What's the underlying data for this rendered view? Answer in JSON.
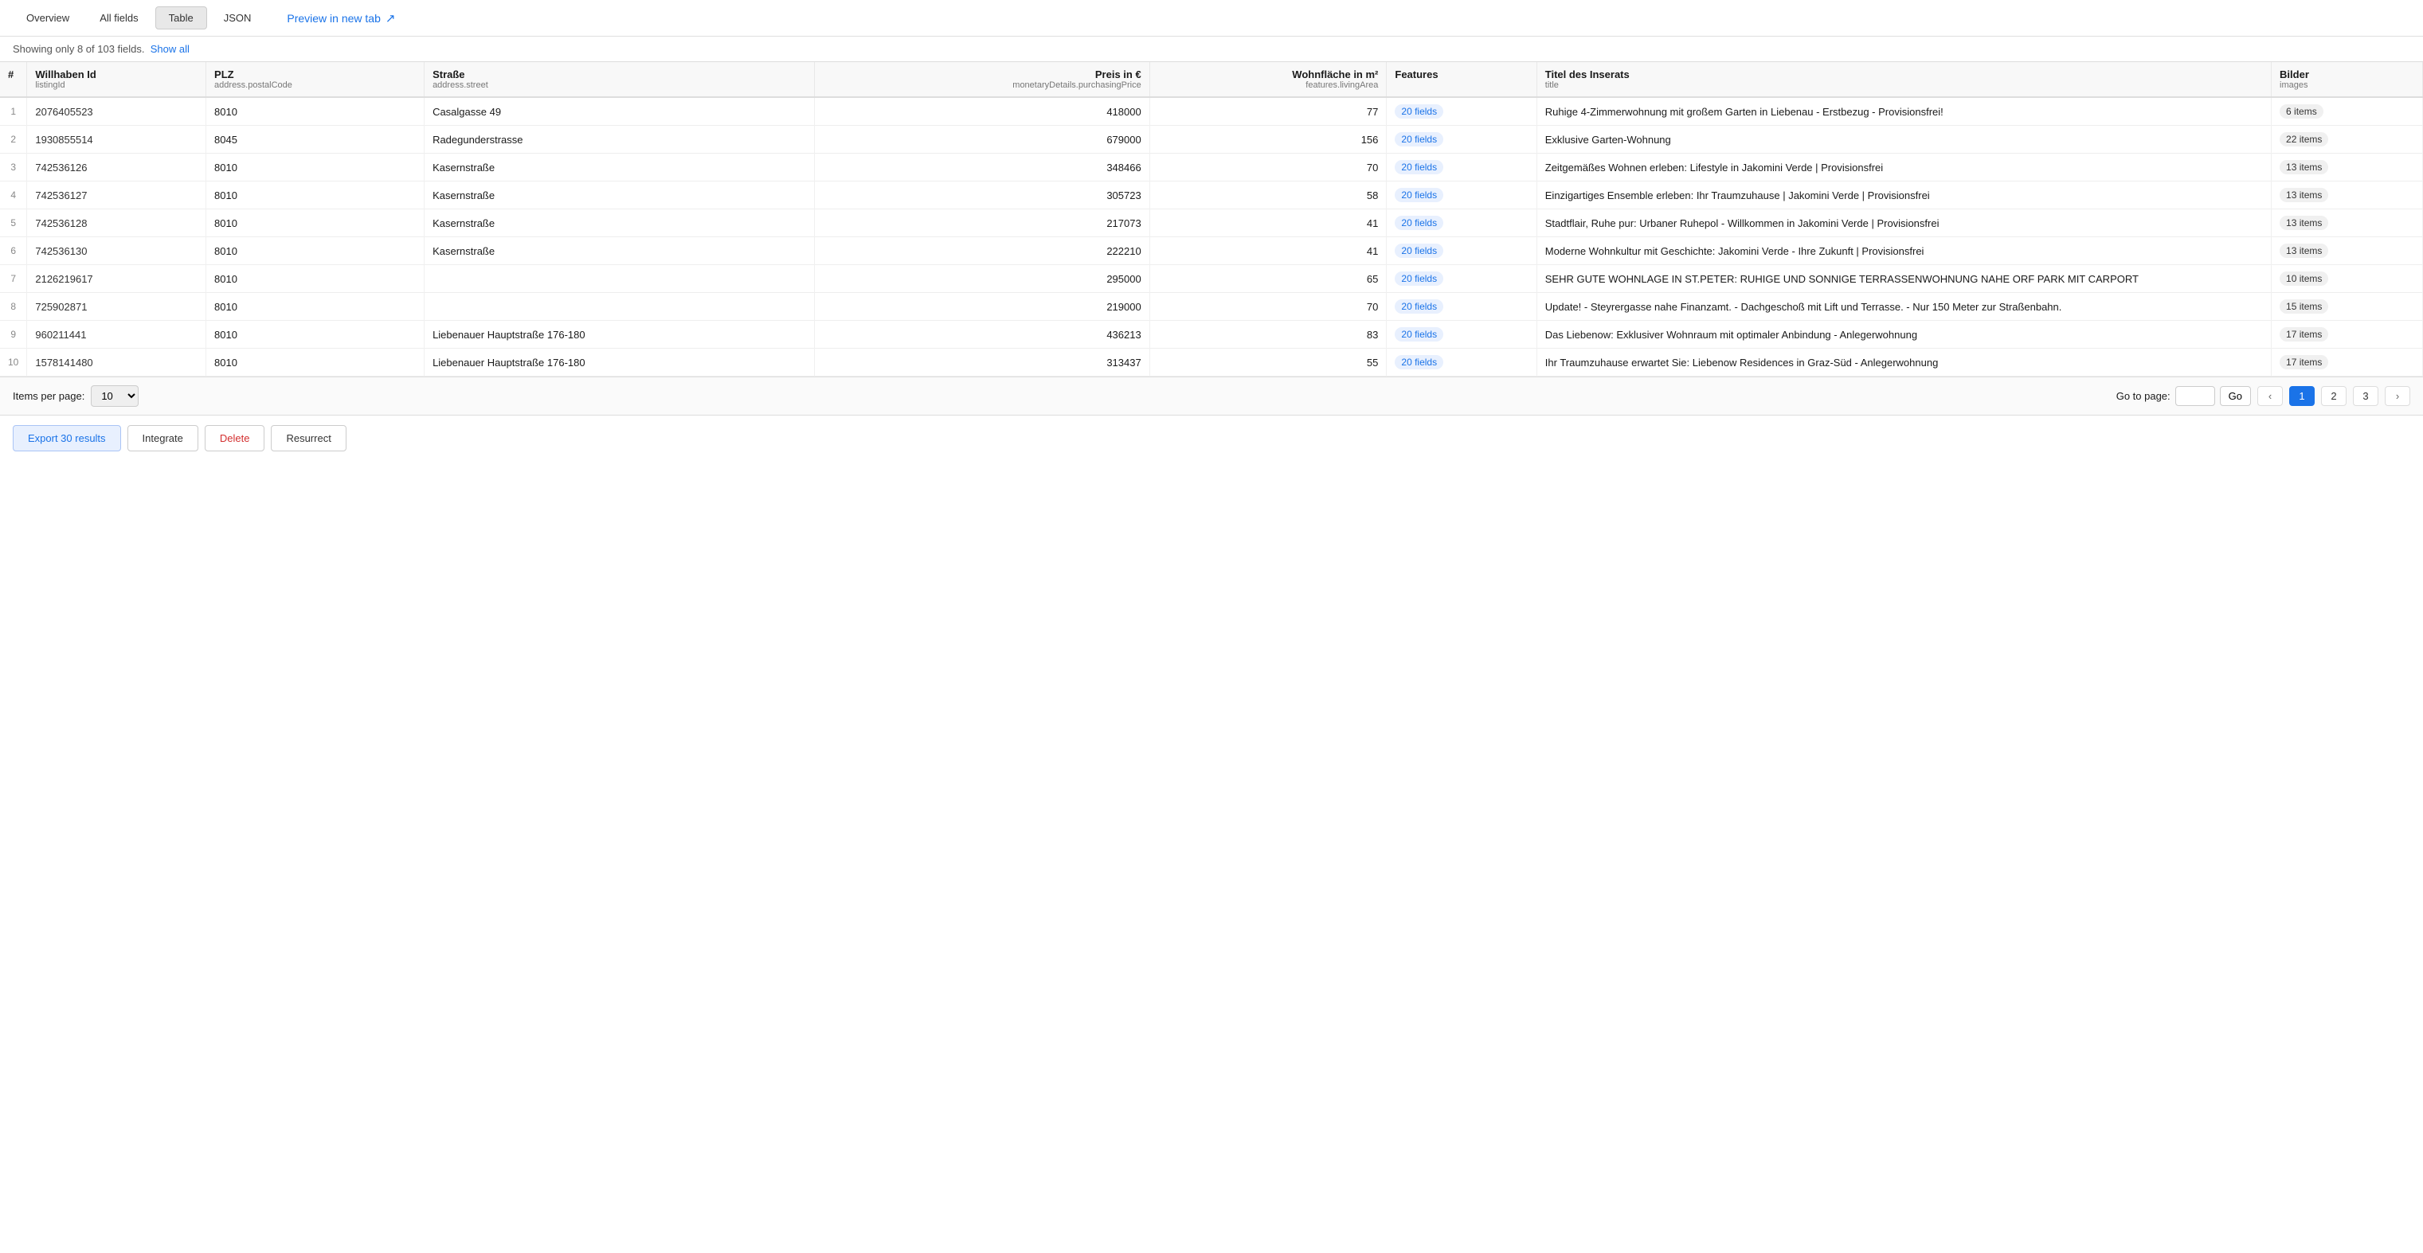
{
  "tabs": {
    "overview": "Overview",
    "all_fields": "All fields",
    "table": "Table",
    "json": "JSON",
    "active": "Table"
  },
  "preview": {
    "label": "Preview in new tab",
    "icon": "↗"
  },
  "info_bar": {
    "text_prefix": "Showing only 8 of 103 fields.",
    "show_all_label": "Show all"
  },
  "columns": [
    {
      "id": "#",
      "field_name": "",
      "field_path": ""
    },
    {
      "id": "willhaben_id",
      "field_name": "Willhaben Id",
      "field_path": "listingId"
    },
    {
      "id": "plz",
      "field_name": "PLZ",
      "field_path": "address.postalCode"
    },
    {
      "id": "strasse",
      "field_name": "Straße",
      "field_path": "address.street"
    },
    {
      "id": "preis",
      "field_name": "Preis in €",
      "field_path": "monetaryDetails.purchasingPrice"
    },
    {
      "id": "wohnflaeche",
      "field_name": "Wohnfläche in m²",
      "field_path": "features.livingArea"
    },
    {
      "id": "features",
      "field_name": "Features",
      "field_path": ""
    },
    {
      "id": "titel",
      "field_name": "Titel des Inserats",
      "field_path": "title"
    },
    {
      "id": "bilder",
      "field_name": "Bilder",
      "field_path": "images"
    }
  ],
  "rows": [
    {
      "num": "1",
      "id": "2076405523",
      "plz": "8010",
      "strasse": "Casalgasse 49",
      "preis": "418000",
      "wohnflaeche": "77",
      "features": "20 fields",
      "titel": "Ruhige 4-Zimmerwohnung mit großem Garten in Liebenau - Erstbezug - Provisionsfrei!",
      "bilder": "6 items"
    },
    {
      "num": "2",
      "id": "1930855514",
      "plz": "8045",
      "strasse": "Radegunderstrasse",
      "preis": "679000",
      "wohnflaeche": "156",
      "features": "20 fields",
      "titel": "Exklusive Garten-Wohnung",
      "bilder": "22 items"
    },
    {
      "num": "3",
      "id": "742536126",
      "plz": "8010",
      "strasse": "Kasernstraße",
      "preis": "348466",
      "wohnflaeche": "70",
      "features": "20 fields",
      "titel": "Zeitgemäßes Wohnen erleben: Lifestyle in Jakomini Verde | Provisionsfrei",
      "bilder": "13 items"
    },
    {
      "num": "4",
      "id": "742536127",
      "plz": "8010",
      "strasse": "Kasernstraße",
      "preis": "305723",
      "wohnflaeche": "58",
      "features": "20 fields",
      "titel": "Einzigartiges Ensemble erleben: Ihr Traumzuhause | Jakomini Verde | Provisionsfrei",
      "bilder": "13 items"
    },
    {
      "num": "5",
      "id": "742536128",
      "plz": "8010",
      "strasse": "Kasernstraße",
      "preis": "217073",
      "wohnflaeche": "41",
      "features": "20 fields",
      "titel": "Stadtflair, Ruhe pur: Urbaner Ruhepol - Willkommen in Jakomini Verde | Provisionsfrei",
      "bilder": "13 items"
    },
    {
      "num": "6",
      "id": "742536130",
      "plz": "8010",
      "strasse": "Kasernstraße",
      "preis": "222210",
      "wohnflaeche": "41",
      "features": "20 fields",
      "titel": "Moderne Wohnkultur mit Geschichte: Jakomini Verde - Ihre Zukunft | Provisionsfrei",
      "bilder": "13 items"
    },
    {
      "num": "7",
      "id": "2126219617",
      "plz": "8010",
      "strasse": "",
      "preis": "295000",
      "wohnflaeche": "65",
      "features": "20 fields",
      "titel": "SEHR GUTE WOHNLAGE IN ST.PETER: RUHIGE UND SONNIGE TERRASSENWOHNUNG NAHE ORF PARK MIT CARPORT",
      "bilder": "10 items"
    },
    {
      "num": "8",
      "id": "725902871",
      "plz": "8010",
      "strasse": "",
      "preis": "219000",
      "wohnflaeche": "70",
      "features": "20 fields",
      "titel": "Update! - Steyrergasse nahe Finanzamt. - Dachgeschoß mit Lift und Terrasse. - Nur 150 Meter zur Straßenbahn.",
      "bilder": "15 items"
    },
    {
      "num": "9",
      "id": "960211441",
      "plz": "8010",
      "strasse": "Liebenauer Hauptstraße 176-180",
      "preis": "436213",
      "wohnflaeche": "83",
      "features": "20 fields",
      "titel": "Das Liebenow: Exklusiver Wohnraum mit optimaler Anbindung - Anlegerwohnung",
      "bilder": "17 items"
    },
    {
      "num": "10",
      "id": "1578141480",
      "plz": "8010",
      "strasse": "Liebenauer Hauptstraße 176-180",
      "preis": "313437",
      "wohnflaeche": "55",
      "features": "20 fields",
      "titel": "Ihr Traumzuhause erwartet Sie: Liebenow Residences in Graz-Süd - Anlegerwohnung",
      "bilder": "17 items"
    }
  ],
  "pagination": {
    "items_per_page_label": "Items per page:",
    "items_per_page_value": "10",
    "go_to_page_label": "Go to page:",
    "go_label": "Go",
    "current_page": 1,
    "pages": [
      "1",
      "2",
      "3"
    ]
  },
  "actions": {
    "export_label": "Export 30 results",
    "integrate_label": "Integrate",
    "delete_label": "Delete",
    "resurrect_label": "Resurrect"
  }
}
